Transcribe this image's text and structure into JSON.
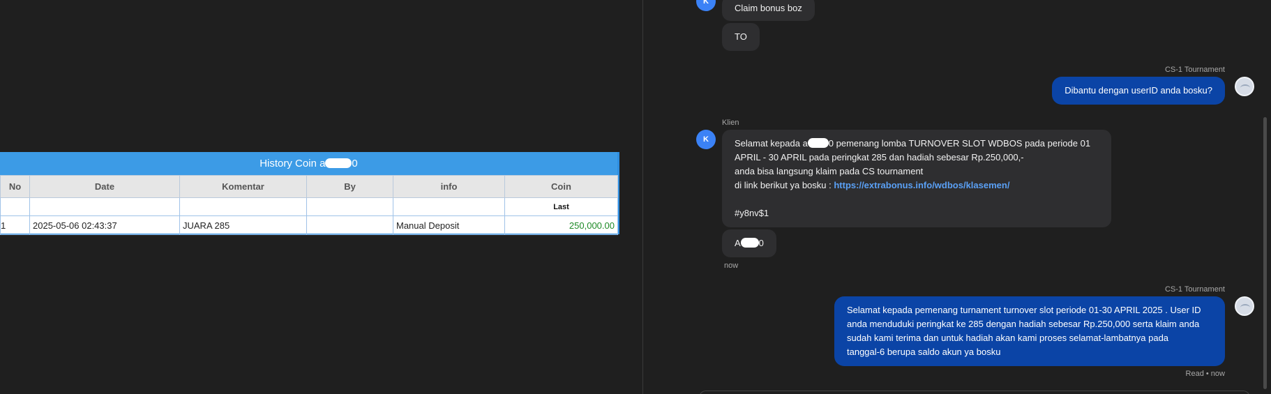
{
  "history": {
    "title_prefix": "History Coin a",
    "title_suffix": "0",
    "columns": [
      "No",
      "Date",
      "Komentar",
      "By",
      "info",
      "Coin"
    ],
    "subheader_last": "Last",
    "rows": [
      {
        "no": "1",
        "date": "2025-05-06 02:43:37",
        "komentar": "JUARA 285",
        "by": "",
        "info": "Manual Deposit",
        "coin": "250,000.00"
      }
    ]
  },
  "chat": {
    "msg1": {
      "avatar": "K",
      "text": "Claim bonus boz"
    },
    "msg2": {
      "text": "TO"
    },
    "agent_name_1": "CS-1 Tournament",
    "out1": {
      "text": "Dibantu dengan userID anda bosku?"
    },
    "client_label": "Klien",
    "msg3": {
      "avatar": "K",
      "line1_prefix": "Selamat kepada a",
      "line1_suffix": "0 pemenang lomba TURNOVER SLOT WDBOS pada periode 01",
      "line2": "APRIL - 30 APRIL pada peringkat 285 dan hadiah sebesar Rp.250,000,-",
      "line3": "anda bisa langsung klaim pada CS tournament",
      "line4_prefix": "di link berikut ya bosku : ",
      "link": "https://extrabonus.info/wdbos/klasemen/",
      "line6": "#y8nv$1"
    },
    "msg4": {
      "prefix": "A",
      "suffix": "0"
    },
    "time_now": "now",
    "agent_name_2": "CS-1 Tournament",
    "out2": {
      "line1": "Selamat kepada pemenang turnament turnover slot periode 01-30 APRIL 2025 . User ID",
      "line2": "anda menduduki peringkat ke 285 dengan hadiah sebesar Rp.250,000 serta klaim anda",
      "line3": "sudah kami terima dan untuk hadiah akan kami proses selamat-lambatnya pada",
      "line4": "tanggal-6 berupa saldo akun ya bosku"
    },
    "read_status": "Read • now"
  }
}
